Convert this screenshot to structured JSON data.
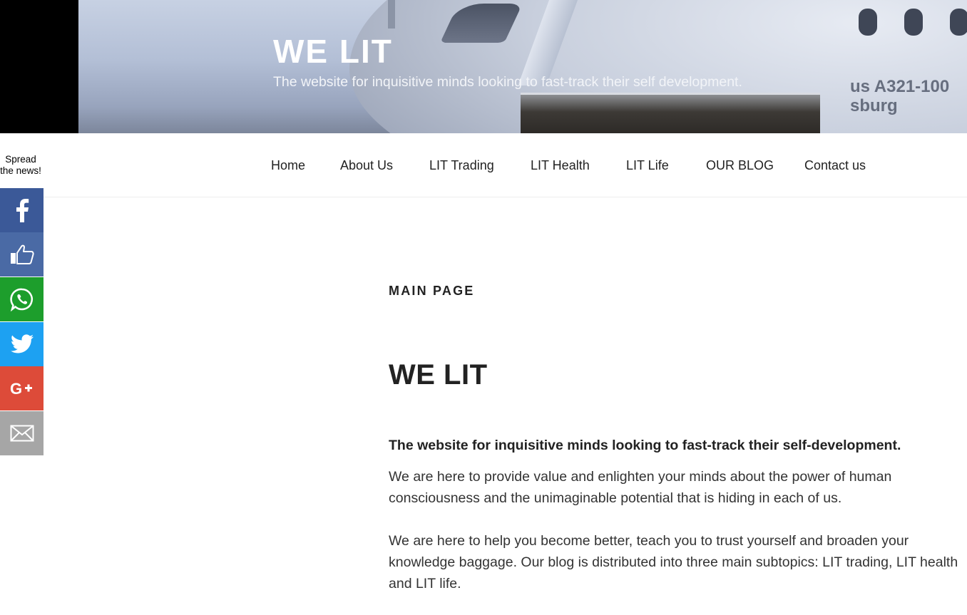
{
  "header": {
    "title": "WE LIT",
    "tagline": "The website for inquisitive minds looking to fast-track their self development.",
    "photo_text_line1": "us A321-100",
    "photo_text_line2": "sburg"
  },
  "nav": {
    "items": [
      {
        "label": "Home"
      },
      {
        "label": "About Us"
      },
      {
        "label": "LIT Trading"
      },
      {
        "label": "LIT Health"
      },
      {
        "label": "LIT Life"
      },
      {
        "label": "OUR BLOG"
      },
      {
        "label": "Contact us"
      }
    ]
  },
  "share": {
    "label": "Spread the news!",
    "buttons": [
      {
        "icon": "facebook-icon",
        "color": "#3b5998"
      },
      {
        "icon": "thumbs-up-icon",
        "color": "#4a6aa5"
      },
      {
        "icon": "whatsapp-icon",
        "color": "#1d9e2c"
      },
      {
        "icon": "twitter-icon",
        "color": "#1da1f2"
      },
      {
        "icon": "google-plus-icon",
        "color": "#dd4b39"
      },
      {
        "icon": "email-icon",
        "color": "#a6a6a6"
      }
    ]
  },
  "main": {
    "section_label": "MAIN PAGE",
    "heading": "WE LIT",
    "lead": "The website for inquisitive minds looking to fast-track their self-development.",
    "paragraphs": [
      "We are here to provide value and enlighten your minds about the power of human consciousness and the unimaginable potential that is hiding in each of us.",
      "We are here to help you become better, teach you to trust yourself and broaden your knowledge baggage. Our blog is distributed into three main subtopics: LIT trading, LIT health and LIT life."
    ]
  }
}
